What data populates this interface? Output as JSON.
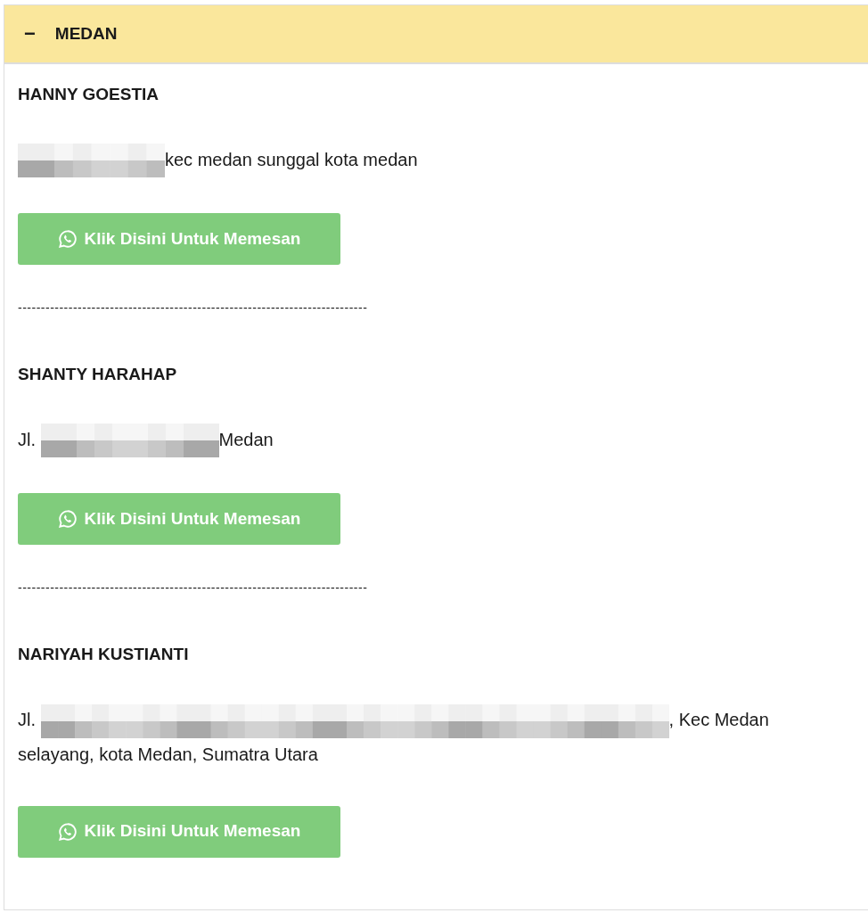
{
  "section": {
    "title": "MEDAN",
    "toggle": "−"
  },
  "entries": [
    {
      "name": "HANNY GOESTIA",
      "address": [
        {
          "kind": "redacted"
        },
        {
          "kind": "text",
          "text": "kec medan sunggal kota medan"
        }
      ],
      "button": "Klik Disini Untuk Memesan",
      "separator": "----------------------------------------------------------------------------"
    },
    {
      "name": "SHANTY HARAHAP",
      "address": [
        {
          "kind": "text",
          "text": "Jl."
        },
        {
          "kind": "redacted"
        },
        {
          "kind": "text",
          "text": "Medan"
        }
      ],
      "button": "Klik Disini Untuk Memesan",
      "separator": "----------------------------------------------------------------------------"
    },
    {
      "name": "NARIYAH KUSTIANTI",
      "address": [
        {
          "kind": "text",
          "text": "Jl."
        },
        {
          "kind": "redacted"
        },
        {
          "kind": "text",
          "text": ", Kec Medan"
        },
        {
          "kind": "text",
          "text": "selayang, kota Medan, Sumatra Utara"
        }
      ],
      "button": "Klik Disini Untuk Memesan"
    }
  ]
}
